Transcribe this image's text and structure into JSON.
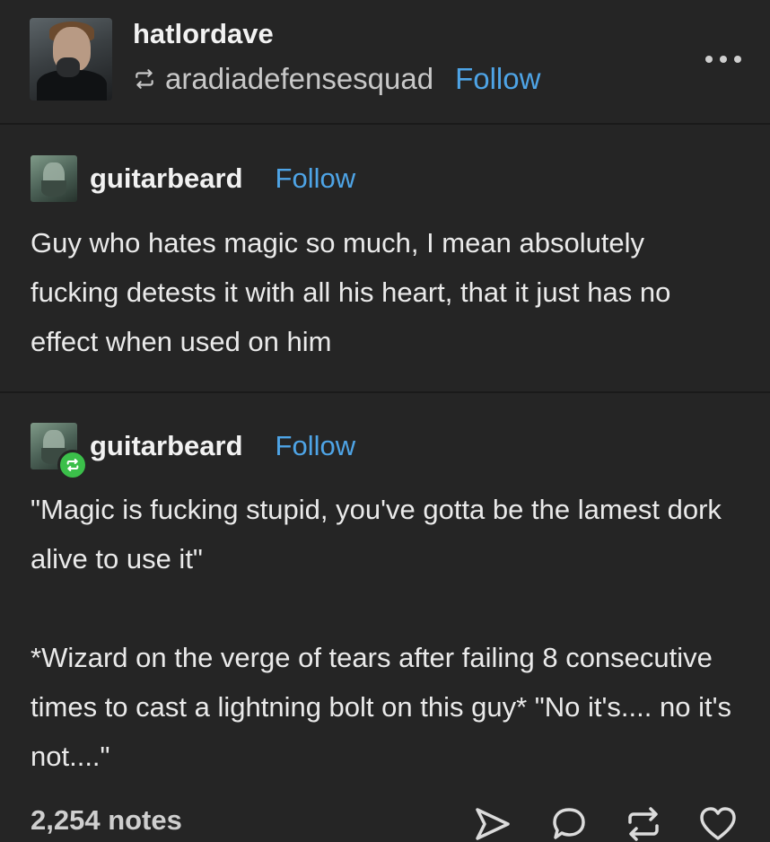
{
  "header": {
    "blog_name": "hatlordave",
    "reblogged_from": "aradiadefensesquad",
    "follow_label": "Follow",
    "more_icon": "more-dots-icon"
  },
  "posts": [
    {
      "username": "guitarbeard",
      "follow_label": "Follow",
      "paragraphs": [
        "Guy who hates magic so much, I mean absolutely fucking detests it with all his heart, that it just has no effect when used on him"
      ]
    },
    {
      "username": "guitarbeard",
      "follow_label": "Follow",
      "paragraphs": [
        "\"Magic is fucking stupid, you've gotta be the lamest dork alive to use it\"",
        "*Wizard on the verge of tears after failing 8 consecutive times to cast a lightning bolt on this guy* \"No it's.... no it's not....\""
      ]
    }
  ],
  "footer": {
    "notes": "2,254 notes",
    "icons": [
      "share-icon",
      "reply-icon",
      "reblog-icon",
      "like-icon"
    ]
  },
  "colors": {
    "background": "#252525",
    "follow": "#4ea4e6",
    "reblog_badge": "#3bbf4a"
  }
}
